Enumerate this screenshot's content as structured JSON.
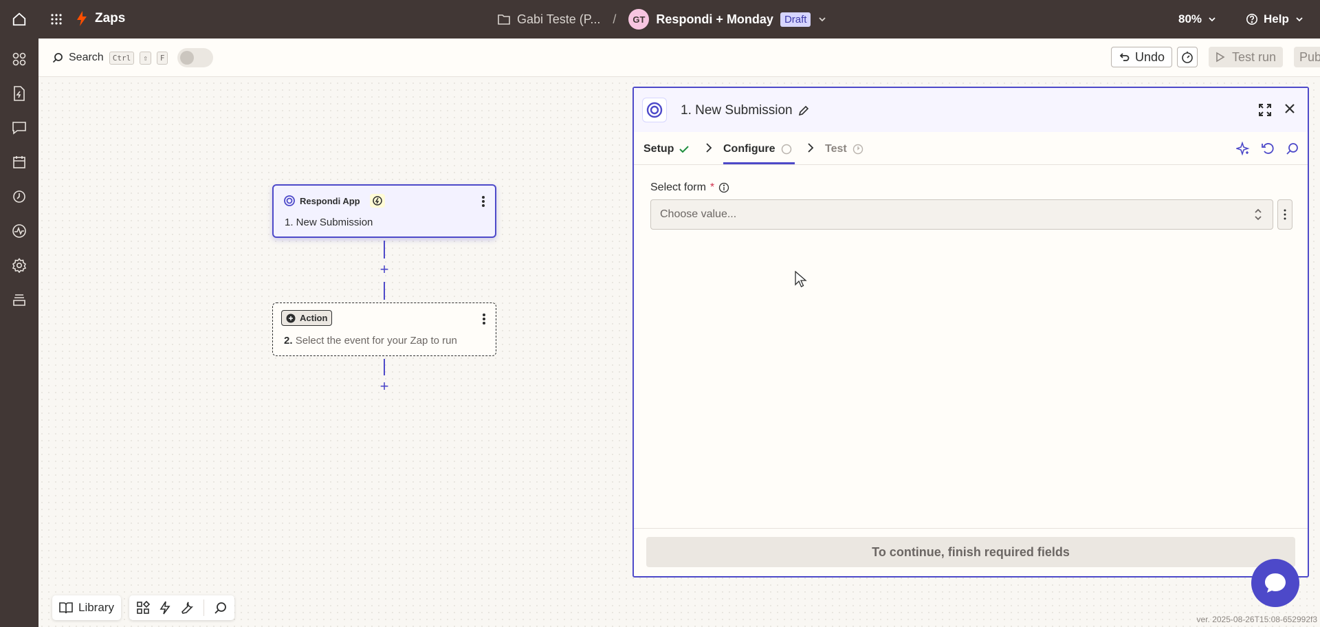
{
  "topbar": {
    "product": "Zaps",
    "folder": "Gabi Teste (P...",
    "separator": "/",
    "avatar_initials": "GT",
    "zap_name": "Respondi + Monday",
    "status": "Draft",
    "zoom": "80%",
    "help": "Help"
  },
  "toolbar": {
    "search_label": "Search",
    "shortcut": [
      "Ctrl",
      "⇧",
      "F"
    ],
    "undo_label": "Undo",
    "test_run_label": "Test run",
    "publish_label": "Publish"
  },
  "canvas": {
    "trigger": {
      "app": "Respondi App",
      "step": "1. New Submission"
    },
    "action": {
      "chip": "Action",
      "step_num": "2.",
      "step_text": "Select the event for your Zap to run"
    }
  },
  "panel": {
    "title": "1. New Submission",
    "tabs": {
      "setup": "Setup",
      "configure": "Configure",
      "test": "Test"
    },
    "field_label": "Select form",
    "required_mark": "*",
    "field_placeholder": "Choose value...",
    "footer_button": "To continue, finish required fields"
  },
  "bottom": {
    "library_label": "Library",
    "version": "ver. 2025-08-26T15:08-652992f3"
  },
  "colors": {
    "topbar": "#413735",
    "accent": "#4d49c9",
    "brand_orange": "#ff4f00"
  }
}
